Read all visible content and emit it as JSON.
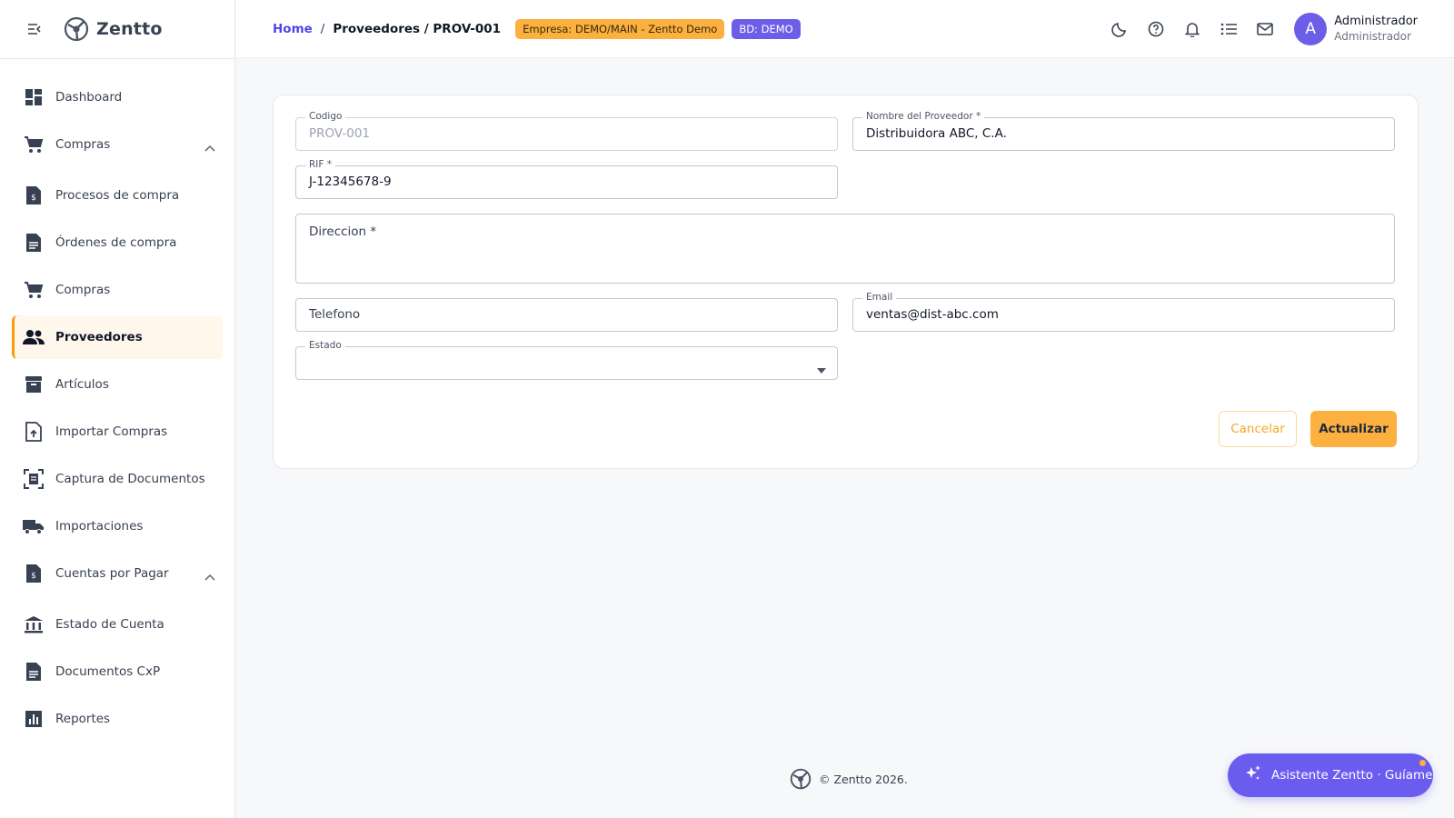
{
  "app": {
    "name": "Zentto"
  },
  "sidebar": {
    "items": [
      {
        "label": "Dashboard",
        "icon": "dashboard-icon"
      },
      {
        "label": "Compras",
        "icon": "cart-icon",
        "group": true,
        "expanded": true
      },
      {
        "label": "Procesos de compra",
        "icon": "invoice-dollar-icon"
      },
      {
        "label": "Órdenes de compra",
        "icon": "document-icon"
      },
      {
        "label": "Compras",
        "icon": "cart-icon"
      },
      {
        "label": "Proveedores",
        "icon": "people-icon",
        "active": true
      },
      {
        "label": "Artículos",
        "icon": "archive-icon"
      },
      {
        "label": "Importar Compras",
        "icon": "file-upload-icon"
      },
      {
        "label": "Captura de Documentos",
        "icon": "document-scanner-icon"
      },
      {
        "label": "Importaciones",
        "icon": "truck-icon"
      },
      {
        "label": "Cuentas por Pagar",
        "icon": "invoice-dollar-icon",
        "group": true,
        "expanded": true
      },
      {
        "label": "Estado de Cuenta",
        "icon": "bank-icon"
      },
      {
        "label": "Documentos CxP",
        "icon": "document-icon"
      },
      {
        "label": "Reportes",
        "icon": "bar-chart-icon"
      }
    ]
  },
  "header": {
    "breadcrumb": {
      "home": "Home",
      "separator": "/",
      "current": "Proveedores / PROV-001"
    },
    "company_badge": "Empresa: DEMO/MAIN - Zentto Demo",
    "db_badge": "BD: DEMO",
    "icons": [
      "moon-icon",
      "help-icon",
      "bell-icon",
      "list-icon",
      "mail-icon"
    ],
    "user": {
      "initial": "A",
      "name": "Administrador",
      "role": "Administrador"
    }
  },
  "form": {
    "codigo": {
      "label": "Codigo",
      "value": "PROV-001"
    },
    "nombre": {
      "label": "Nombre del Proveedor *",
      "value": "Distribuidora ABC, C.A."
    },
    "rif": {
      "label": "RIF *",
      "value": "J-12345678-9"
    },
    "direccion": {
      "label": "Direccion *",
      "value": ""
    },
    "telefono": {
      "label": "Telefono",
      "value": ""
    },
    "email": {
      "label": "Email",
      "value": "ventas@dist-abc.com"
    },
    "estado": {
      "label": "Estado",
      "value": ""
    },
    "cancel_label": "Cancelar",
    "update_label": "Actualizar"
  },
  "footer": {
    "text": "© Zentto 2026."
  },
  "assistant": {
    "label": "Asistente Zentto · Guíame"
  },
  "colors": {
    "accent": "#fbb040",
    "primary": "#6d5ee8",
    "link": "#4f46e5"
  }
}
